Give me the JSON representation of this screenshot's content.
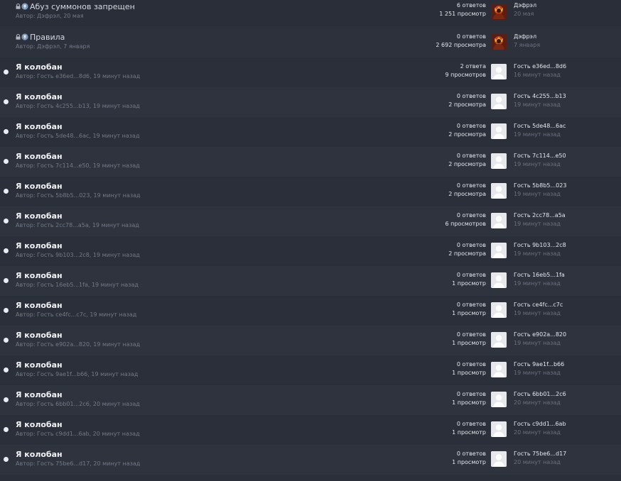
{
  "pinned": [
    {
      "title": "Абуз суммонов запрещен",
      "meta": "Автор: Дэфрэл, 20 мая",
      "replies": "6 ответов",
      "views": "1 251 просмотр",
      "last_name": "Дэфрэл",
      "last_time": "20 мая"
    },
    {
      "title": "Правила",
      "meta": "Автор: Дэфрэл, 7 января",
      "replies": "0 ответов",
      "views": "2 692 просмотра",
      "last_name": "Дэфрэл",
      "last_time": "7 января"
    }
  ],
  "topics": [
    {
      "title": "Я колобан",
      "meta": "Автор: Гость e36ed...8d6, 19 минут назад",
      "replies": "2 ответа",
      "views": "9 просмотров",
      "last_name": "Гость e36ed...8d6",
      "last_time": "16 минут назад"
    },
    {
      "title": "Я колобан",
      "meta": "Автор: Гость 4c255...b13, 19 минут назад",
      "replies": "0 ответов",
      "views": "2 просмотра",
      "last_name": "Гость 4c255...b13",
      "last_time": "19 минут назад"
    },
    {
      "title": "Я колобан",
      "meta": "Автор: Гость 5de48...6ac, 19 минут назад",
      "replies": "0 ответов",
      "views": "2 просмотра",
      "last_name": "Гость 5de48...6ac",
      "last_time": "19 минут назад"
    },
    {
      "title": "Я колобан",
      "meta": "Автор: Гость 7c114...e50, 19 минут назад",
      "replies": "0 ответов",
      "views": "2 просмотра",
      "last_name": "Гость 7c114...e50",
      "last_time": "19 минут назад"
    },
    {
      "title": "Я колобан",
      "meta": "Автор: Гость 5b8b5...023, 19 минут назад",
      "replies": "0 ответов",
      "views": "2 просмотра",
      "last_name": "Гость 5b8b5...023",
      "last_time": "19 минут назад"
    },
    {
      "title": "Я колобан",
      "meta": "Автор: Гость 2cc78...a5a, 19 минут назад",
      "replies": "0 ответов",
      "views": "6 просмотров",
      "last_name": "Гость 2cc78...a5a",
      "last_time": "19 минут назад"
    },
    {
      "title": "Я колобан",
      "meta": "Автор: Гость 9b103...2c8, 19 минут назад",
      "replies": "0 ответов",
      "views": "2 просмотра",
      "last_name": "Гость 9b103...2c8",
      "last_time": "19 минут назад"
    },
    {
      "title": "Я колобан",
      "meta": "Автор: Гость 16eb5...1fa, 19 минут назад",
      "replies": "0 ответов",
      "views": "1 просмотр",
      "last_name": "Гость 16eb5...1fa",
      "last_time": "19 минут назад"
    },
    {
      "title": "Я колобан",
      "meta": "Автор: Гость ce4fc...c7c, 19 минут назад",
      "replies": "0 ответов",
      "views": "1 просмотр",
      "last_name": "Гость ce4fc...c7c",
      "last_time": "19 минут назад"
    },
    {
      "title": "Я колобан",
      "meta": "Автор: Гость e902a...820, 19 минут назад",
      "replies": "0 ответов",
      "views": "1 просмотр",
      "last_name": "Гость e902a...820",
      "last_time": "19 минут назад"
    },
    {
      "title": "Я колобан",
      "meta": "Автор: Гость 9ae1f...b66, 19 минут назад",
      "replies": "0 ответов",
      "views": "1 просмотр",
      "last_name": "Гость 9ae1f...b66",
      "last_time": "19 минут назад"
    },
    {
      "title": "Я колобан",
      "meta": "Автор: Гость 6bb01...2c6, 20 минут назад",
      "replies": "0 ответов",
      "views": "1 просмотр",
      "last_name": "Гость 6bb01...2c6",
      "last_time": "20 минут назад"
    },
    {
      "title": "Я колобан",
      "meta": "Автор: Гость c9dd1...6ab, 20 минут назад",
      "replies": "0 ответов",
      "views": "1 просмотр",
      "last_name": "Гость c9dd1...6ab",
      "last_time": "20 минут назад"
    },
    {
      "title": "Я колобан",
      "meta": "Автор: Гость 75be6...d17, 20 минут назад",
      "replies": "0 ответов",
      "views": "1 просмотр",
      "last_name": "Гость 75be6...d17",
      "last_time": "20 минут назад"
    }
  ]
}
